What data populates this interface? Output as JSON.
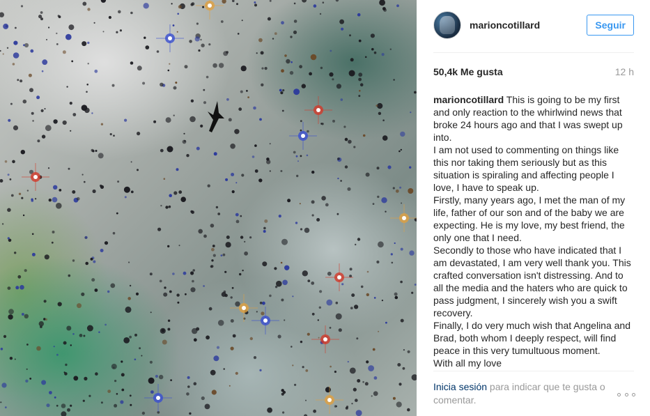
{
  "post": {
    "username": "marioncotillard",
    "follow_label": "Seguir",
    "likes": "50,4k Me gusta",
    "time": "12 h",
    "caption_user": "marioncotillard",
    "caption_paragraphs": [
      "This is going to be my first and only reaction to the whirlwind news that broke 24 hours ago and that I was swept up into.",
      "I am not used to commenting on things like this nor taking them seriously but as this situation is spiraling and affecting people I love, I have to speak up.",
      "Firstly, many years ago, I met the man of my life, father of our son and of the baby we are expecting. He is my love, my best friend, the only one that I need.",
      "Secondly to those who have indicated that I am devastated, I am very well thank you. This crafted conversation isn't distressing. And to all the media and the haters who are quick to pass judgment, I sincerely wish you a swift recovery.",
      "Finally, I do very much wish that Angelina and Brad, both whom I deeply respect, will find peace in this very tumultuous moment.",
      "With all my love"
    ],
    "login_link": "Inicia sesión",
    "login_rest": " para indicar que te gusta o comentar."
  },
  "icons": {
    "more": "more-options-icon",
    "photo_bird": "bird-silhouette"
  },
  "colors": {
    "accent": "#3897f0",
    "link": "#003569",
    "muted": "#999999"
  }
}
